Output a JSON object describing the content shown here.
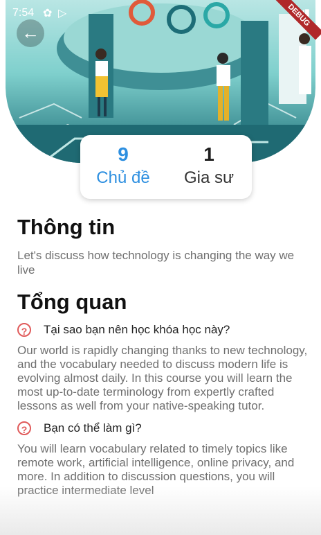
{
  "status_bar": {
    "time": "7:54"
  },
  "hero": {
    "debug_label": "DEBUG"
  },
  "stats": {
    "topics": {
      "value": "9",
      "label": "Chủ đề"
    },
    "tutors": {
      "value": "1",
      "label": "Gia sư"
    }
  },
  "info": {
    "heading": "Thông tin",
    "text": "Let's discuss how technology is changing the way we live"
  },
  "overview": {
    "heading": "Tổng quan",
    "q1": "Tại sao bạn nên học khóa học này?",
    "a1": "Our world is rapidly changing thanks to new technology, and the vocabulary needed to discuss modern life is evolving almost daily. In this course you will learn the most up-to-date terminology from expertly crafted lessons as well from your native-speaking tutor.",
    "q2": "Bạn có thể làm gì?",
    "a2": "You will learn vocabulary related to timely topics like remote work, artificial intelligence, online privacy, and more. In addition to discussion questions, you will practice intermediate level"
  },
  "colors": {
    "accent": "#2d8fe0",
    "question_icon": "#e05a5a"
  }
}
